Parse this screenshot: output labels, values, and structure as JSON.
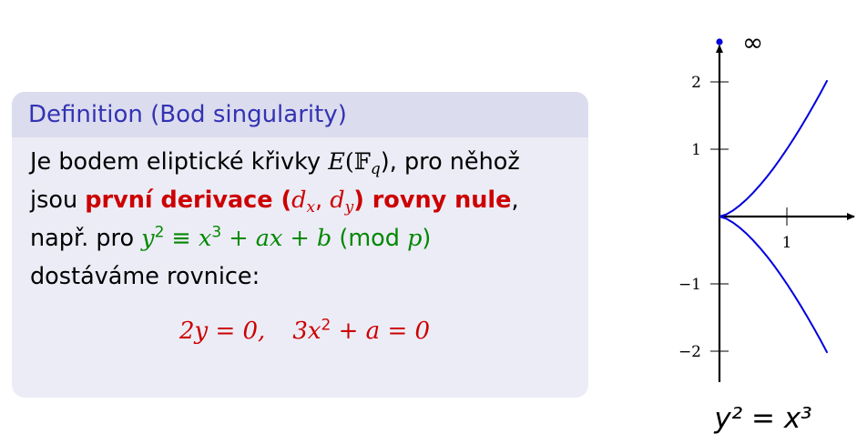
{
  "definition": {
    "heading": "Definition (Bod singularity)",
    "line1_text": "Je bodem eliptické křivky ",
    "line1_E": "E",
    "line1_Fq": "(𝔽",
    "line1_q": "q",
    "line1_end": "), pro něhož",
    "line2_text": "jsou ",
    "line2_bold1": "první derivace (",
    "line2_dx": "d",
    "line2_x": "x",
    "line2_comma": ", ",
    "line2_dy": "d",
    "line2_y": "y",
    "line2_bold2": ") rovny nule",
    "line2_end": ",",
    "line3_text": "např. pro ",
    "line3_y": "y",
    "line3_exp2": "2",
    "line3_equiv": " ≡ ",
    "line3_x": "x",
    "line3_exp3": "3",
    "line3_rest": " + ax + b",
    "line3_mod": " (mod ",
    "line3_p": "p",
    "line3_close": ")",
    "line4_text": "dostáváme rovnice:",
    "eq_part1": "2y = 0,",
    "eq_part2": "3x",
    "eq_exp": "2",
    "eq_part3": " + a = 0"
  },
  "chart_data": {
    "type": "line",
    "title": "",
    "equation_label": "y² = x³",
    "infinity_label": "∞",
    "xlim": [
      0,
      1.6
    ],
    "ylim": [
      -2.3,
      2.3
    ],
    "xticks": [
      1
    ],
    "yticks": [
      -2,
      -1,
      1,
      2
    ],
    "series": [
      {
        "x": [
          0,
          0.1,
          0.2,
          0.3,
          0.4,
          0.5,
          0.6,
          0.7,
          0.8,
          0.9,
          1.0,
          1.1,
          1.2,
          1.3,
          1.4,
          1.5,
          1.6
        ],
        "y": [
          0,
          0.0316,
          0.0894,
          0.1643,
          0.253,
          0.3536,
          0.4648,
          0.5857,
          0.7155,
          0.8538,
          1.0,
          1.1537,
          1.3145,
          1.4822,
          1.6565,
          1.8371,
          2.0239
        ]
      },
      {
        "x": [
          0,
          0.1,
          0.2,
          0.3,
          0.4,
          0.5,
          0.6,
          0.7,
          0.8,
          0.9,
          1.0,
          1.1,
          1.2,
          1.3,
          1.4,
          1.5,
          1.6
        ],
        "y": [
          0,
          -0.0316,
          -0.0894,
          -0.1643,
          -0.253,
          -0.3536,
          -0.4648,
          -0.5857,
          -0.7155,
          -0.8538,
          -1.0,
          -1.1537,
          -1.3145,
          -1.4822,
          -1.6565,
          -1.8371,
          -2.0239
        ]
      }
    ],
    "colors": {
      "curve": "#0000dd",
      "axis": "#000000",
      "point": "#0000dd"
    }
  }
}
